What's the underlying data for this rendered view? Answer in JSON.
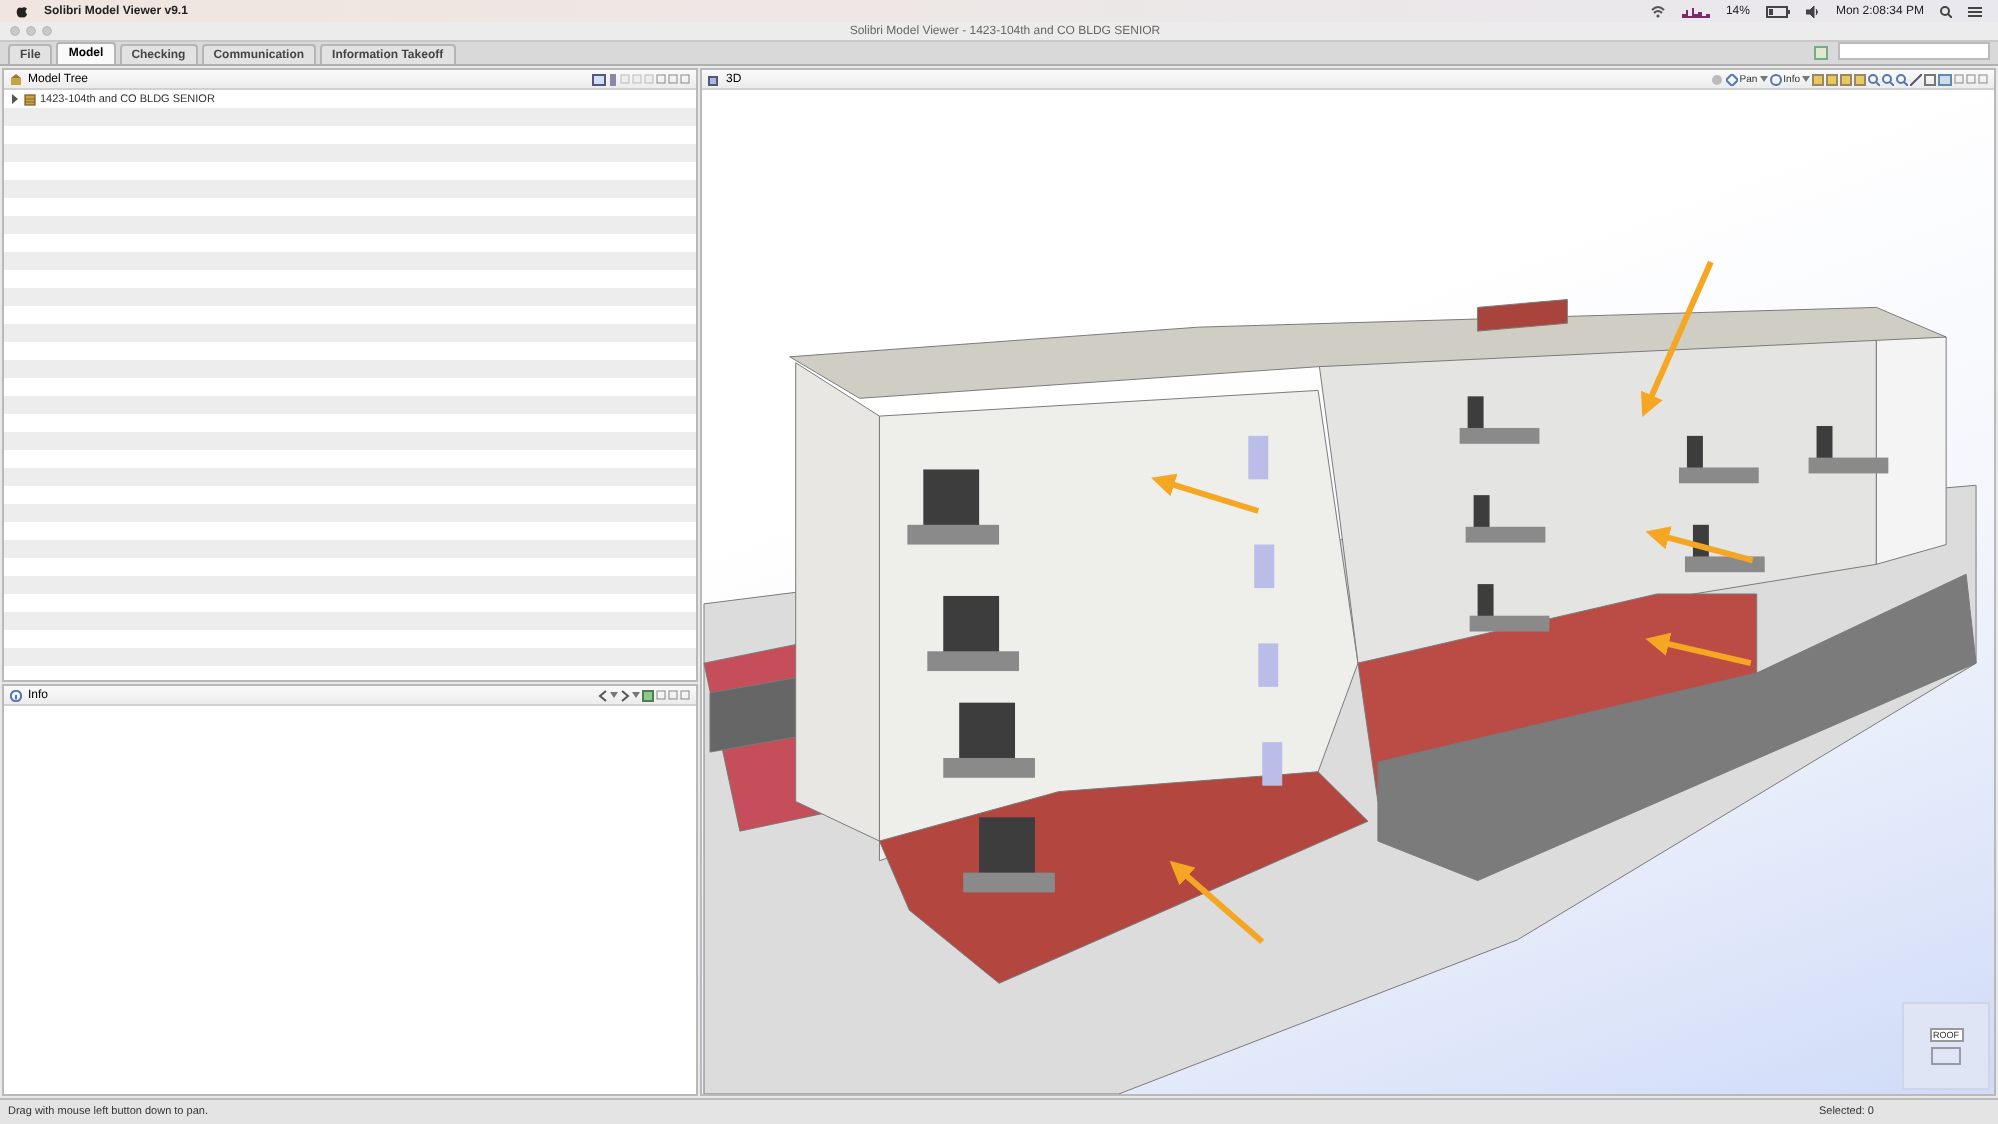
{
  "menu_bar": {
    "app_name": "Solibri Model Viewer v9.1",
    "battery": "14%",
    "clock": "Mon 2:08:34 PM"
  },
  "window": {
    "title": "Solibri Model Viewer - 1423-104th and CO BLDG SENIOR"
  },
  "tabs": [
    {
      "label": "File",
      "selected": false
    },
    {
      "label": "Model",
      "selected": true
    },
    {
      "label": "Checking",
      "selected": false
    },
    {
      "label": "Communication",
      "selected": false
    },
    {
      "label": "Information Takeoff",
      "selected": false
    }
  ],
  "model_tree": {
    "title": "Model Tree",
    "items": [
      {
        "label": "1423-104th and CO BLDG SENIOR",
        "expanded": false
      }
    ]
  },
  "info_panel": {
    "title": "Info"
  },
  "view_3d": {
    "title": "3D",
    "toolbar": [
      {
        "label": "Pan"
      },
      {
        "label": "Info"
      }
    ],
    "nav_cube": {
      "label": "ROOF"
    }
  },
  "status_bar": {
    "hint": "Drag with mouse left button down to pan.",
    "selection": "Selected: 0"
  }
}
